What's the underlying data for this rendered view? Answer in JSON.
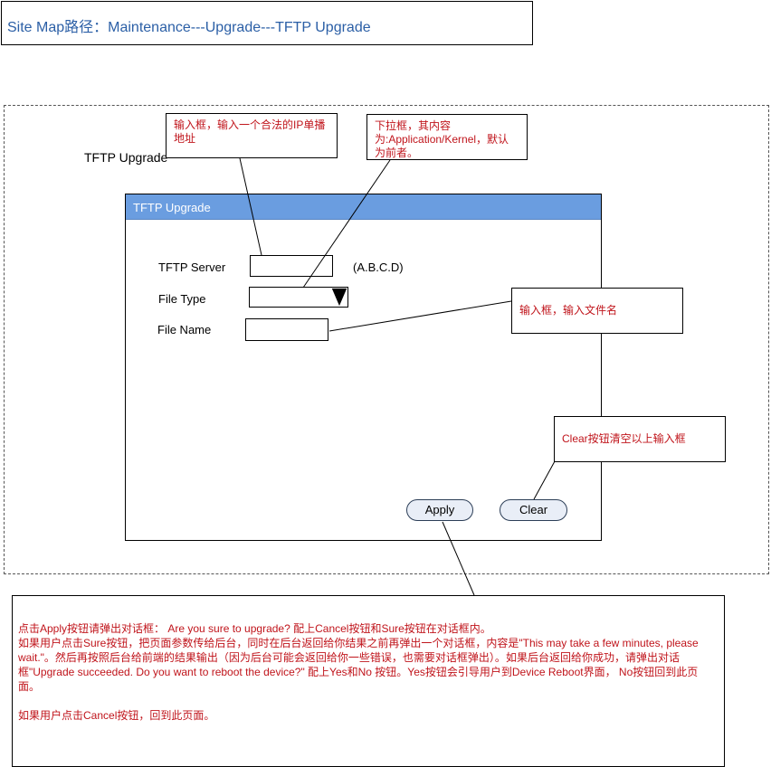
{
  "sitemap": {
    "text": "Site Map路径：Maintenance---Upgrade---TFTP Upgrade"
  },
  "page": {
    "outer_title": "TFTP Upgrade"
  },
  "panel": {
    "header": "TFTP Upgrade",
    "fields": {
      "tftp_server_label": "TFTP Server",
      "tftp_server_hint": "(A.B.C.D)",
      "file_type_label": "File Type",
      "file_name_label": "File Name"
    },
    "buttons": {
      "apply": "Apply",
      "clear": "Clear"
    }
  },
  "callouts": {
    "ip_input": "输入框，输入一个合法的IP单播地址",
    "file_type": "下拉框，其内容为:Application/Kernel，默认为前者。",
    "file_name": "输入框，输入文件名",
    "clear": "Clear按钮清空以上输入框"
  },
  "notes": {
    "line1": "点击Apply按钮请弹出对话框： Are you sure to upgrade? 配上Cancel按钮和Sure按钮在对话框内。",
    "line2": "如果用户点击Sure按钮，把页面参数传给后台，同时在后台返回给你结果之前再弹出一个对话框，内容是\"This may take a few minutes, please wait.\"。然后再按照后台给前端的结果输出（因为后台可能会返回给你一些错误，也需要对话框弹出）。如果后台返回给你成功，请弹出对话框\"Upgrade succeeded. Do you want to reboot the device?\" 配上Yes和No 按钮。Yes按钮会引导用户到Device Reboot界面， No按钮回到此页面。",
    "line3": "如果用户点击Cancel按钮，回到此页面。"
  }
}
